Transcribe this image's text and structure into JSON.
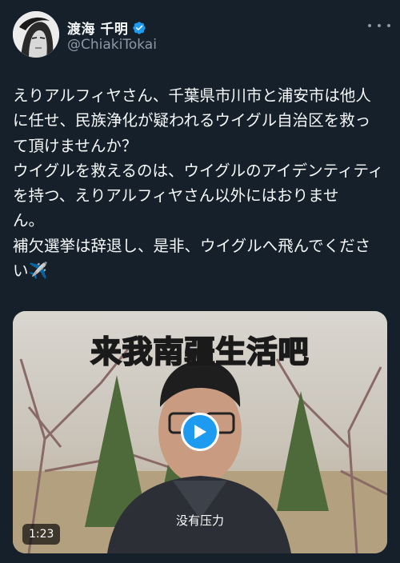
{
  "header": {
    "display_name": "渡海 千明",
    "handle": "@ChiakiTokai"
  },
  "tweet": {
    "lines": [
      "えりアルフィヤさん、千葉県市川市と浦安市は他人",
      "に任せ、民族浄化が疑われるウイグル自治区を救っ",
      "て頂けませんか？",
      "ウイグルを救えるのは、ウイグルのアイデンティティ",
      "を持つ、えりアルフィヤさん以外にはおりませ",
      "ん。",
      "補欠選挙は辞退し、是非、ウイグルへ飛んでくださ",
      "い✈️"
    ]
  },
  "media": {
    "caption_top": "来我南疆生活吧",
    "subtitle": "没有压力",
    "duration": "1:23"
  },
  "colors": {
    "background": "#15202b",
    "text": "#f7f9f9",
    "muted": "#8b98a5",
    "accent": "#1d9bf0",
    "caption": "#ffe45c"
  },
  "icons": [
    "verified-badge-icon",
    "more-options-icon",
    "play-icon"
  ]
}
